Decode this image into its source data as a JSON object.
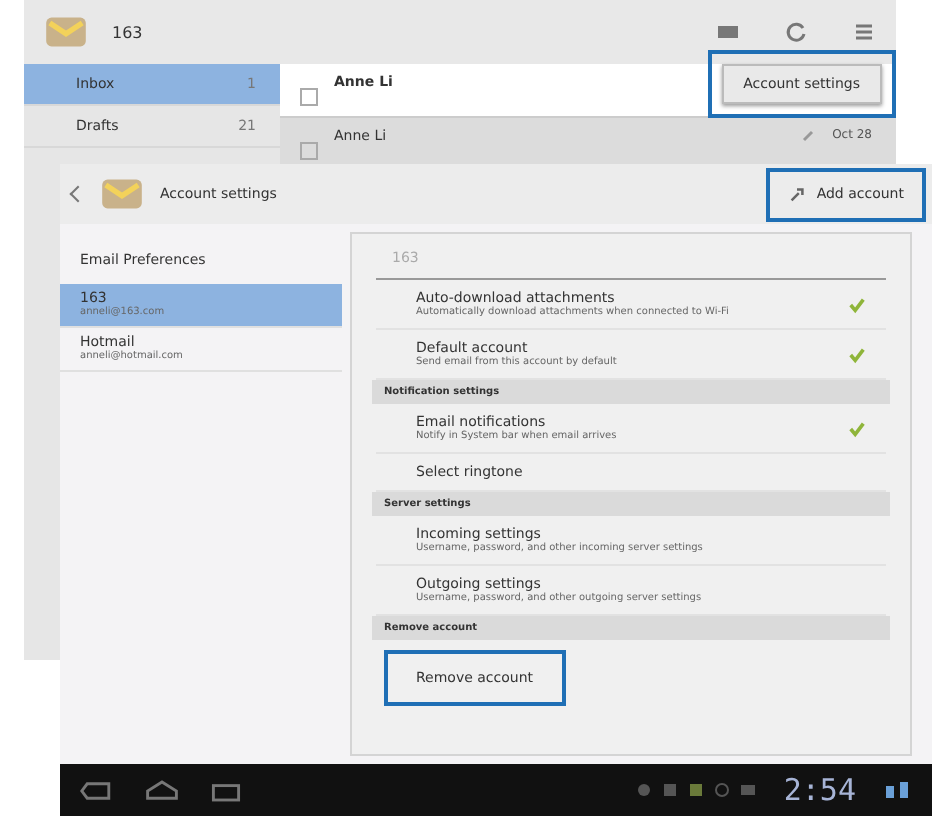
{
  "mail_screen": {
    "account": "163",
    "folders": [
      {
        "label": "Inbox",
        "count": "1",
        "selected": true
      },
      {
        "label": "Drafts",
        "count": "21",
        "selected": false
      }
    ],
    "messages": [
      {
        "sender": "Anne Li",
        "attachment": false,
        "unread": true
      },
      {
        "sender": "Anne Li",
        "date": "Oct 28",
        "attachment": true,
        "unread": false
      }
    ],
    "menu": [
      {
        "label": "Account settings",
        "highlighted": true
      }
    ]
  },
  "settings_screen": {
    "title": "Account settings",
    "action": {
      "label": "Add account",
      "highlighted": true
    },
    "preferences_label": "Email Preferences",
    "accounts": [
      {
        "name": "163",
        "email": "anneli@163.com",
        "selected": true
      },
      {
        "name": "Hotmail",
        "email": "anneli@hotmail.com",
        "selected": false
      }
    ],
    "account_header": "163",
    "items": [
      {
        "kind": "check",
        "title": "Auto-download attachments",
        "summary": "Automatically download attachments when connected to Wi-Fi",
        "checked": true
      },
      {
        "kind": "check",
        "title": "Default account",
        "summary": "Send email from this account by default",
        "checked": true
      },
      {
        "kind": "section",
        "title": "Notification settings"
      },
      {
        "kind": "check",
        "title": "Email notifications",
        "summary": "Notify in System bar when email arrives",
        "checked": true
      },
      {
        "kind": "plain",
        "title": "Select ringtone"
      },
      {
        "kind": "section",
        "title": "Server settings"
      },
      {
        "kind": "plain",
        "title": "Incoming settings",
        "summary": "Username, password, and other incoming server settings"
      },
      {
        "kind": "plain",
        "title": "Outgoing settings",
        "summary": "Username, password, and other outgoing server settings"
      },
      {
        "kind": "section",
        "title": "Remove account"
      },
      {
        "kind": "button",
        "title": "Remove account",
        "highlighted": true
      }
    ]
  },
  "system_bar": {
    "time": "2:54"
  }
}
